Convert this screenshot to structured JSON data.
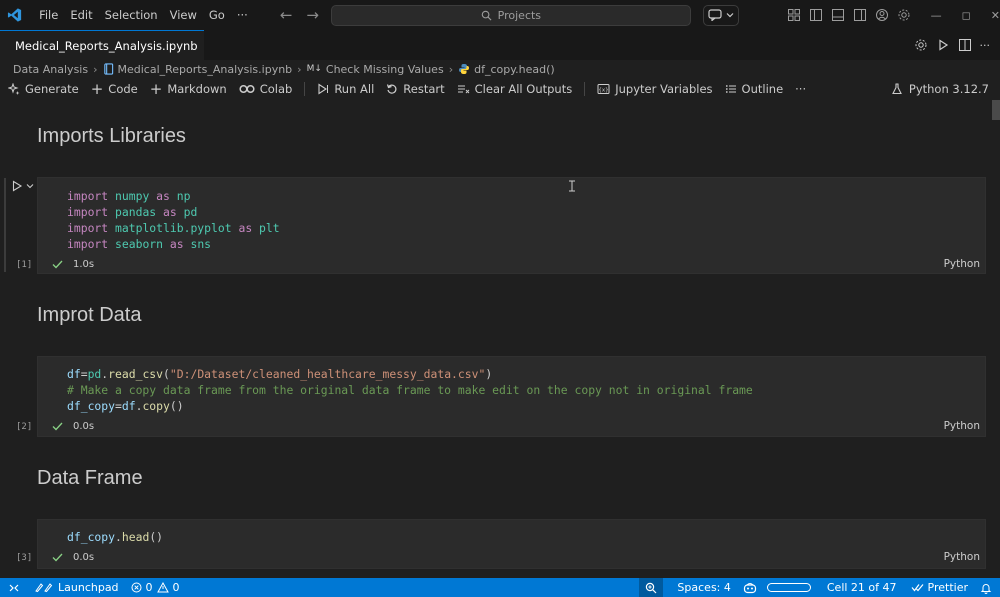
{
  "titlebar": {
    "menu": [
      "File",
      "Edit",
      "Selection",
      "View",
      "Go",
      "···"
    ],
    "search_placeholder": "Projects"
  },
  "tab": {
    "label": "Medical_Reports_Analysis.ipynb"
  },
  "breadcrumb": {
    "items": [
      "Data Analysis",
      "Medical_Reports_Analysis.ipynb",
      "Check Missing Values",
      "df_copy.head()"
    ]
  },
  "toolbar": {
    "generate": "Generate",
    "code": "Code",
    "markdown": "Markdown",
    "colab": "Colab",
    "run_all": "Run All",
    "restart": "Restart",
    "clear_outputs": "Clear All Outputs",
    "jupyter_variables": "Jupyter Variables",
    "outline": "Outline",
    "more": "···",
    "kernel": "Python 3.12.7"
  },
  "cells": [
    {
      "heading": "Imports Libraries",
      "exec_count": "[1]",
      "duration": "1.0s",
      "language": "Python"
    },
    {
      "heading": "Improt Data",
      "exec_count": "[2]",
      "duration": "0.0s",
      "language": "Python"
    },
    {
      "heading": "Data Frame",
      "exec_count": "[3]",
      "duration": "0.0s",
      "language": "Python"
    }
  ],
  "code": {
    "c1": [
      {
        "kw1": "import",
        "mod": "numpy",
        "kw2": "as",
        "alias": "np"
      },
      {
        "kw1": "import",
        "mod": "pandas",
        "kw2": "as",
        "alias": "pd"
      },
      {
        "kw1": "import",
        "mod": "matplotlib.pyplot",
        "kw2": "as",
        "alias": "plt"
      },
      {
        "kw1": "import",
        "mod": "seaborn",
        "kw2": "as",
        "alias": "sns"
      }
    ],
    "c2": {
      "line1_var": "df",
      "line1_eq": "=",
      "line1_mod": "pd",
      "line1_dot": ".",
      "line1_fn": "read_csv",
      "line1_open": "(",
      "line1_str": "\"D:/Dataset/cleaned_healthcare_messy_data.csv\"",
      "line1_close": ")",
      "line2_cmt": "# Make a copy data frame from the original data frame to make edit on the copy not in original frame",
      "line3_var": "df_copy",
      "line3_eq": "=",
      "line3_var2": "df",
      "line3_dot": ".",
      "line3_fn": "copy",
      "line3_paren": "()"
    },
    "c3": {
      "var": "df_copy",
      "dot": ".",
      "fn": "head",
      "paren": "()"
    }
  },
  "statusbar": {
    "launchpad": "Launchpad",
    "errors": "0",
    "warnings": "0",
    "spaces": "Spaces: 4",
    "cell_position": "Cell 21 of 47",
    "prettier": "Prettier"
  },
  "colors": {
    "accent": "#0078d4",
    "background": "#1f1f1f",
    "cell_bg": "#2b2b2b",
    "success": "#89d185"
  }
}
